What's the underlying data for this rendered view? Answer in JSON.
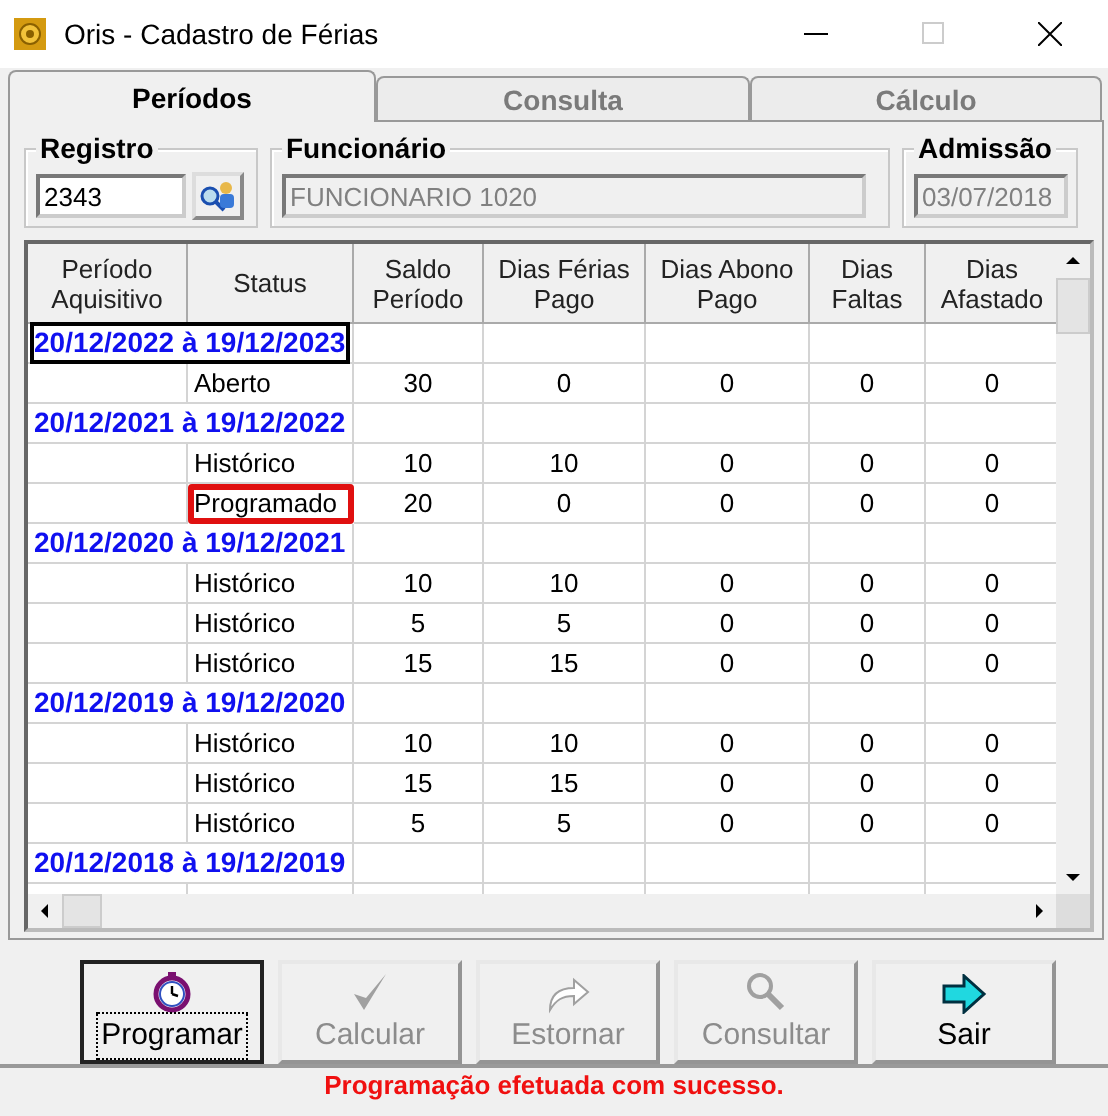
{
  "window": {
    "title": "Oris - Cadastro de Férias"
  },
  "tabs": [
    {
      "label": "Períodos",
      "selected": true
    },
    {
      "label": "Consulta",
      "selected": false
    },
    {
      "label": "Cálculo",
      "selected": false
    }
  ],
  "fields": {
    "registro": {
      "label": "Registro",
      "value": "2343",
      "disabled": false
    },
    "funcionario": {
      "label": "Funcionário",
      "value": "FUNCIONARIO 1020",
      "disabled": true
    },
    "admissao": {
      "label": "Admissão",
      "value": "03/07/2018",
      "disabled": true
    }
  },
  "table": {
    "columns": [
      "Período Aquisitivo",
      "Status",
      "Saldo Período",
      "Dias Férias Pago",
      "Dias Abono Pago",
      "Dias Faltas",
      "Dias Afastado"
    ],
    "rows": [
      {
        "kind": "period",
        "label": "20/12/2022 à 19/12/2023",
        "focused": true
      },
      {
        "kind": "entry",
        "cells": [
          "Aberto",
          "30",
          "0",
          "0",
          "0",
          "0"
        ],
        "highlighted": false
      },
      {
        "kind": "period",
        "label": "20/12/2021 à 19/12/2022",
        "focused": false
      },
      {
        "kind": "entry",
        "cells": [
          "Histórico",
          "10",
          "10",
          "0",
          "0",
          "0"
        ],
        "highlighted": false
      },
      {
        "kind": "entry",
        "cells": [
          "Programado",
          "20",
          "0",
          "0",
          "0",
          "0"
        ],
        "highlighted": true
      },
      {
        "kind": "period",
        "label": "20/12/2020 à 19/12/2021",
        "focused": false
      },
      {
        "kind": "entry",
        "cells": [
          "Histórico",
          "10",
          "10",
          "0",
          "0",
          "0"
        ],
        "highlighted": false
      },
      {
        "kind": "entry",
        "cells": [
          "Histórico",
          "5",
          "5",
          "0",
          "0",
          "0"
        ],
        "highlighted": false
      },
      {
        "kind": "entry",
        "cells": [
          "Histórico",
          "15",
          "15",
          "0",
          "0",
          "0"
        ],
        "highlighted": false
      },
      {
        "kind": "period",
        "label": "20/12/2019 à 19/12/2020",
        "focused": false
      },
      {
        "kind": "entry",
        "cells": [
          "Histórico",
          "10",
          "10",
          "0",
          "0",
          "0"
        ],
        "highlighted": false
      },
      {
        "kind": "entry",
        "cells": [
          "Histórico",
          "15",
          "15",
          "0",
          "0",
          "0"
        ],
        "highlighted": false
      },
      {
        "kind": "entry",
        "cells": [
          "Histórico",
          "5",
          "5",
          "0",
          "0",
          "0"
        ],
        "highlighted": false
      },
      {
        "kind": "period",
        "label": "20/12/2018 à 19/12/2019",
        "focused": false
      }
    ]
  },
  "buttons": [
    {
      "label": "Programar",
      "kind": "schedule",
      "disabled": false,
      "focused": true
    },
    {
      "label": "Calcular",
      "kind": "calculate",
      "disabled": true,
      "focused": false
    },
    {
      "label": "Estornar",
      "kind": "reverse",
      "disabled": true,
      "focused": false
    },
    {
      "label": "Consultar",
      "kind": "query",
      "disabled": true,
      "focused": false
    },
    {
      "label": "Sair",
      "kind": "exit",
      "disabled": false,
      "focused": false
    }
  ],
  "status_bar": {
    "message": "Programação efetuada com sucesso."
  }
}
